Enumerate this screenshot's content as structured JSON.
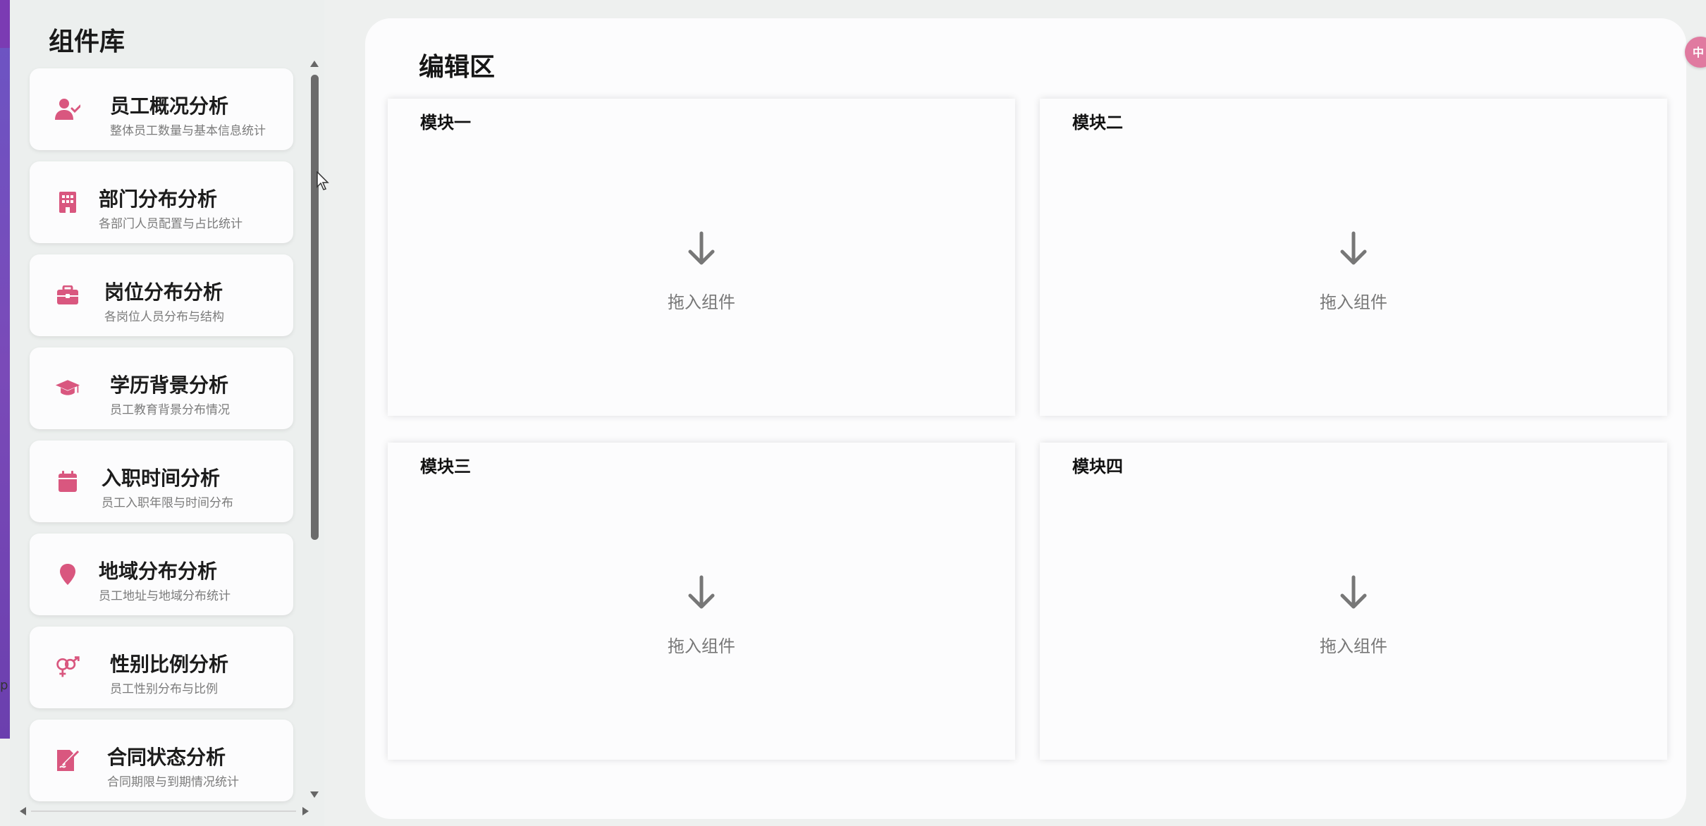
{
  "library": {
    "title": "组件库",
    "items": [
      {
        "icon": "user-check-icon",
        "title": "员工概况分析",
        "subtitle": "整体员工数量与基本信息统计"
      },
      {
        "icon": "building-icon",
        "title": "部门分布分析",
        "subtitle": "各部门人员配置与占比统计"
      },
      {
        "icon": "briefcase-icon",
        "title": "岗位分布分析",
        "subtitle": "各岗位人员分布与结构"
      },
      {
        "icon": "graduation-cap-icon",
        "title": "学历背景分析",
        "subtitle": "员工教育背景分布情况"
      },
      {
        "icon": "calendar-icon",
        "title": "入职时间分析",
        "subtitle": "员工入职年限与时间分布"
      },
      {
        "icon": "map-pin-icon",
        "title": "地域分布分析",
        "subtitle": "员工地址与地域分布统计"
      },
      {
        "icon": "gender-icon",
        "title": "性别比例分析",
        "subtitle": "员工性别分布与比例"
      },
      {
        "icon": "contract-sign-icon",
        "title": "合同状态分析",
        "subtitle": "合同期限与到期情况统计"
      }
    ]
  },
  "editor": {
    "title": "编辑区",
    "modules": [
      {
        "title": "模块一",
        "drop_text": "拖入组件"
      },
      {
        "title": "模块二",
        "drop_text": "拖入组件"
      },
      {
        "title": "模块三",
        "drop_text": "拖入组件"
      },
      {
        "title": "模块四",
        "drop_text": "拖入组件"
      }
    ]
  },
  "colors": {
    "accent": "#d9577f",
    "page_bg": "#eef0ef",
    "card_bg": "#fcfcfd",
    "drop_gray": "#777777"
  }
}
